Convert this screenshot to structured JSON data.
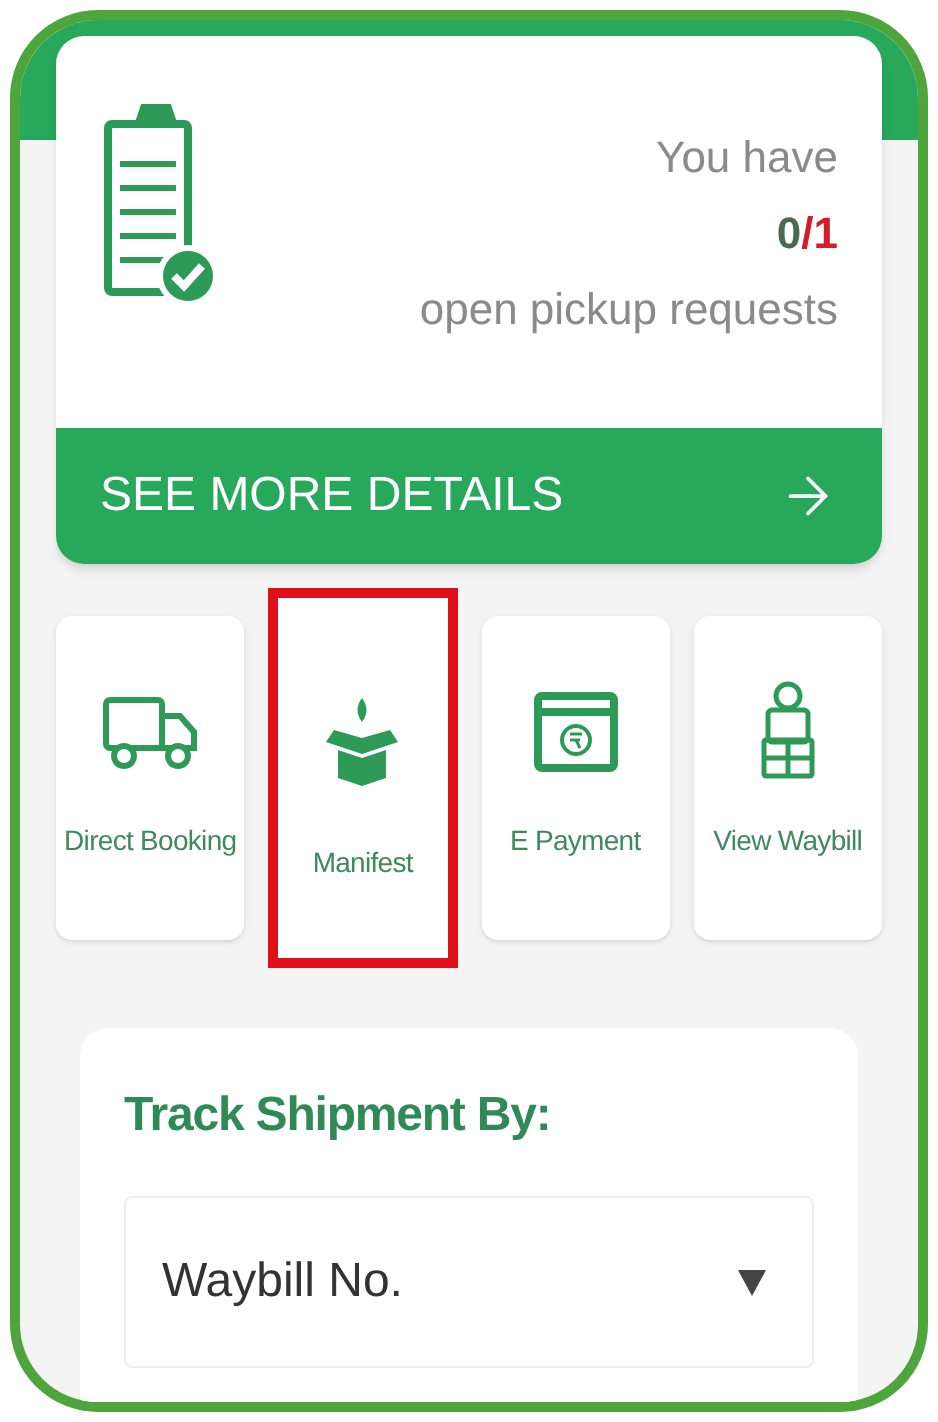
{
  "pickup_card": {
    "line_1": "You have",
    "count": "0",
    "total": "/1",
    "line_3": "open pickup requests",
    "button": "SEE MORE DETAILS"
  },
  "tiles": [
    {
      "label": "Direct Booking",
      "kind": "truck",
      "highlighted": false
    },
    {
      "label": "Manifest",
      "kind": "box",
      "highlighted": true
    },
    {
      "label": "E Payment",
      "kind": "payment",
      "highlighted": false
    },
    {
      "label": "View Waybill",
      "kind": "waybill",
      "highlighted": false
    }
  ],
  "track": {
    "title": "Track Shipment By:",
    "select_value": "Waybill No."
  }
}
